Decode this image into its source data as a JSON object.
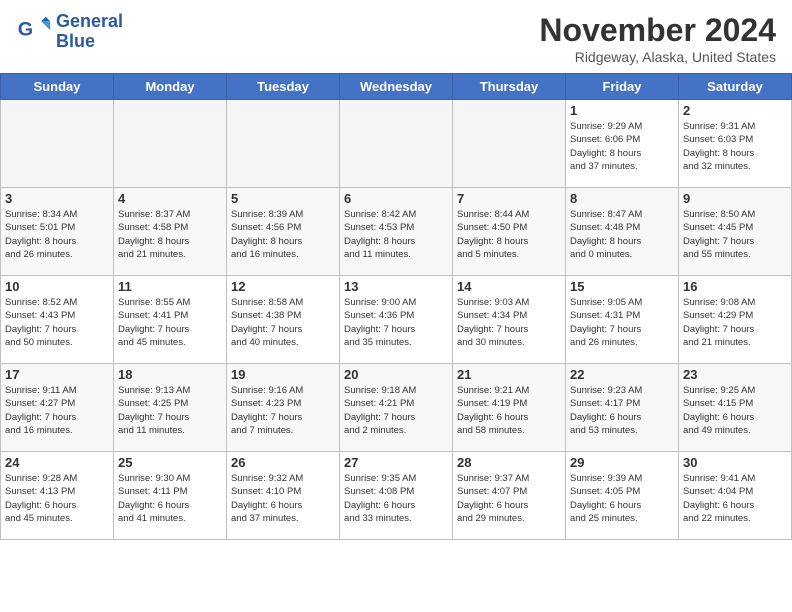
{
  "header": {
    "logo_line1": "General",
    "logo_line2": "Blue",
    "month_title": "November 2024",
    "location": "Ridgeway, Alaska, United States"
  },
  "weekdays": [
    "Sunday",
    "Monday",
    "Tuesday",
    "Wednesday",
    "Thursday",
    "Friday",
    "Saturday"
  ],
  "weeks": [
    [
      {
        "day": "",
        "info": ""
      },
      {
        "day": "",
        "info": ""
      },
      {
        "day": "",
        "info": ""
      },
      {
        "day": "",
        "info": ""
      },
      {
        "day": "",
        "info": ""
      },
      {
        "day": "1",
        "info": "Sunrise: 9:29 AM\nSunset: 6:06 PM\nDaylight: 8 hours\nand 37 minutes."
      },
      {
        "day": "2",
        "info": "Sunrise: 9:31 AM\nSunset: 6:03 PM\nDaylight: 8 hours\nand 32 minutes."
      }
    ],
    [
      {
        "day": "3",
        "info": "Sunrise: 8:34 AM\nSunset: 5:01 PM\nDaylight: 8 hours\nand 26 minutes."
      },
      {
        "day": "4",
        "info": "Sunrise: 8:37 AM\nSunset: 4:58 PM\nDaylight: 8 hours\nand 21 minutes."
      },
      {
        "day": "5",
        "info": "Sunrise: 8:39 AM\nSunset: 4:56 PM\nDaylight: 8 hours\nand 16 minutes."
      },
      {
        "day": "6",
        "info": "Sunrise: 8:42 AM\nSunset: 4:53 PM\nDaylight: 8 hours\nand 11 minutes."
      },
      {
        "day": "7",
        "info": "Sunrise: 8:44 AM\nSunset: 4:50 PM\nDaylight: 8 hours\nand 5 minutes."
      },
      {
        "day": "8",
        "info": "Sunrise: 8:47 AM\nSunset: 4:48 PM\nDaylight: 8 hours\nand 0 minutes."
      },
      {
        "day": "9",
        "info": "Sunrise: 8:50 AM\nSunset: 4:45 PM\nDaylight: 7 hours\nand 55 minutes."
      }
    ],
    [
      {
        "day": "10",
        "info": "Sunrise: 8:52 AM\nSunset: 4:43 PM\nDaylight: 7 hours\nand 50 minutes."
      },
      {
        "day": "11",
        "info": "Sunrise: 8:55 AM\nSunset: 4:41 PM\nDaylight: 7 hours\nand 45 minutes."
      },
      {
        "day": "12",
        "info": "Sunrise: 8:58 AM\nSunset: 4:38 PM\nDaylight: 7 hours\nand 40 minutes."
      },
      {
        "day": "13",
        "info": "Sunrise: 9:00 AM\nSunset: 4:36 PM\nDaylight: 7 hours\nand 35 minutes."
      },
      {
        "day": "14",
        "info": "Sunrise: 9:03 AM\nSunset: 4:34 PM\nDaylight: 7 hours\nand 30 minutes."
      },
      {
        "day": "15",
        "info": "Sunrise: 9:05 AM\nSunset: 4:31 PM\nDaylight: 7 hours\nand 26 minutes."
      },
      {
        "day": "16",
        "info": "Sunrise: 9:08 AM\nSunset: 4:29 PM\nDaylight: 7 hours\nand 21 minutes."
      }
    ],
    [
      {
        "day": "17",
        "info": "Sunrise: 9:11 AM\nSunset: 4:27 PM\nDaylight: 7 hours\nand 16 minutes."
      },
      {
        "day": "18",
        "info": "Sunrise: 9:13 AM\nSunset: 4:25 PM\nDaylight: 7 hours\nand 11 minutes."
      },
      {
        "day": "19",
        "info": "Sunrise: 9:16 AM\nSunset: 4:23 PM\nDaylight: 7 hours\nand 7 minutes."
      },
      {
        "day": "20",
        "info": "Sunrise: 9:18 AM\nSunset: 4:21 PM\nDaylight: 7 hours\nand 2 minutes."
      },
      {
        "day": "21",
        "info": "Sunrise: 9:21 AM\nSunset: 4:19 PM\nDaylight: 6 hours\nand 58 minutes."
      },
      {
        "day": "22",
        "info": "Sunrise: 9:23 AM\nSunset: 4:17 PM\nDaylight: 6 hours\nand 53 minutes."
      },
      {
        "day": "23",
        "info": "Sunrise: 9:25 AM\nSunset: 4:15 PM\nDaylight: 6 hours\nand 49 minutes."
      }
    ],
    [
      {
        "day": "24",
        "info": "Sunrise: 9:28 AM\nSunset: 4:13 PM\nDaylight: 6 hours\nand 45 minutes."
      },
      {
        "day": "25",
        "info": "Sunrise: 9:30 AM\nSunset: 4:11 PM\nDaylight: 6 hours\nand 41 minutes."
      },
      {
        "day": "26",
        "info": "Sunrise: 9:32 AM\nSunset: 4:10 PM\nDaylight: 6 hours\nand 37 minutes."
      },
      {
        "day": "27",
        "info": "Sunrise: 9:35 AM\nSunset: 4:08 PM\nDaylight: 6 hours\nand 33 minutes."
      },
      {
        "day": "28",
        "info": "Sunrise: 9:37 AM\nSunset: 4:07 PM\nDaylight: 6 hours\nand 29 minutes."
      },
      {
        "day": "29",
        "info": "Sunrise: 9:39 AM\nSunset: 4:05 PM\nDaylight: 6 hours\nand 25 minutes."
      },
      {
        "day": "30",
        "info": "Sunrise: 9:41 AM\nSunset: 4:04 PM\nDaylight: 6 hours\nand 22 minutes."
      }
    ]
  ]
}
